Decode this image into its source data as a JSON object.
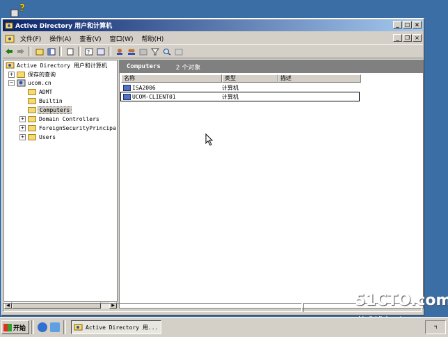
{
  "window": {
    "title": "Active Directory 用户和计算机"
  },
  "menu": [
    "文件(F)",
    "操作(A)",
    "查看(V)",
    "窗口(W)",
    "帮助(H)"
  ],
  "tree": {
    "root": "Active Directory 用户和计算机",
    "saved_queries": "保存的查询",
    "domain": "ucom.cn",
    "children": [
      "ADMT",
      "Builtin",
      "Computers",
      "Domain Controllers",
      "ForeignSecurityPrincipa",
      "Users"
    ],
    "selected": "Computers"
  },
  "right_pane": {
    "header_title": "Computers",
    "header_count": "2 个对象",
    "columns": [
      "名称",
      "类型",
      "描述"
    ],
    "rows": [
      {
        "name": "ISA2006",
        "type": "计算机"
      },
      {
        "name": "UCOM-CLIENT01",
        "type": "计算机"
      }
    ]
  },
  "taskbar": {
    "start_label": "开始",
    "task_label": "Active Directory 用...",
    "tray_text": "ฯ"
  },
  "watermark": {
    "site": "51CTO.com",
    "sub": "技术博客 Blog"
  },
  "colors": {
    "desktop": "#3a6ea5",
    "titlebar": "#0a246a",
    "face": "#d4d0c8"
  }
}
